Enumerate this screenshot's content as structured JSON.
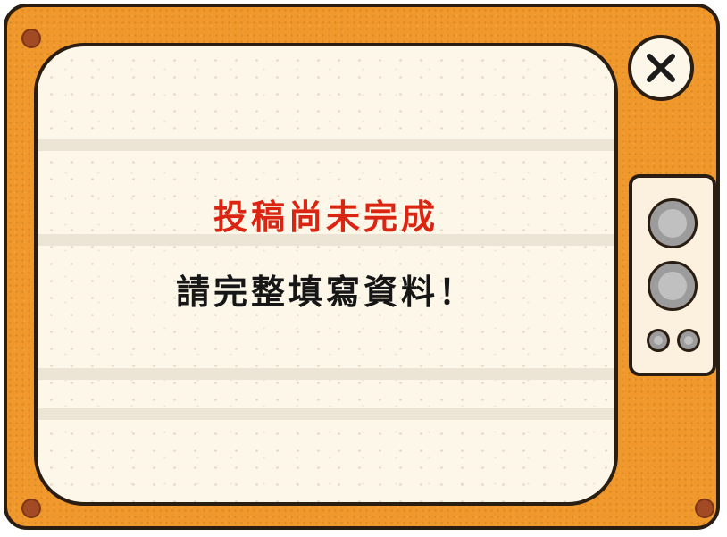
{
  "dialog": {
    "title": "投稿尚未完成",
    "message": "請完整填寫資料！"
  },
  "close_button": {
    "icon": "close-icon"
  },
  "colors": {
    "frame": "#f0982b",
    "screen": "#fdf7ea",
    "title_text": "#d92511",
    "message_text": "#161616",
    "outline": "#2a1d12"
  }
}
